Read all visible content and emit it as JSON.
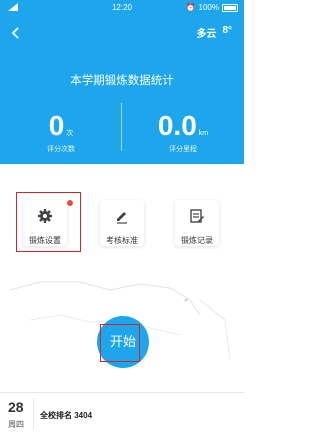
{
  "status_bar": {
    "time": "12:20",
    "battery": "100%"
  },
  "header": {
    "weather": {
      "condition": "多云",
      "temp": "8°"
    },
    "title": "本学期锻炼数据统计",
    "stats": [
      {
        "value": "0",
        "unit": "次",
        "label": "评分次数"
      },
      {
        "value": "0.0",
        "unit": "km",
        "label": "评分里程"
      }
    ]
  },
  "actions": [
    {
      "label": "锻炼设置",
      "icon": "gear-icon"
    },
    {
      "label": "考核标准",
      "icon": "pencil-icon"
    },
    {
      "label": "锻炼记录",
      "icon": "record-icon"
    }
  ],
  "start_label": "开始",
  "footer": {
    "date": "28",
    "weekday": "周四",
    "rank": "全校排名 3404"
  },
  "colors": {
    "primary": "#1ea6ec",
    "highlight": "#d0252d",
    "badge": "#e74c3c"
  }
}
